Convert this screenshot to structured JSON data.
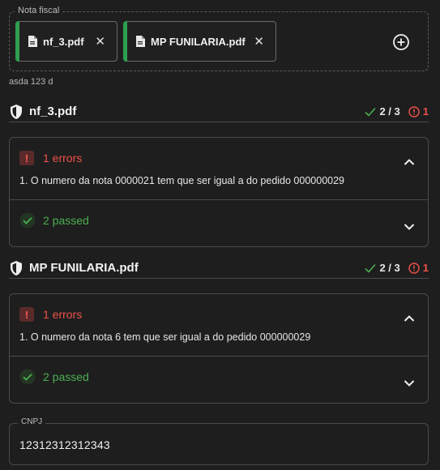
{
  "nota_fiscal": {
    "legend": "Nota fiscal",
    "files": [
      {
        "name": "nf_3.pdf",
        "close": "✕"
      },
      {
        "name": "MP FUNILARIA.pdf",
        "close": "✕"
      }
    ],
    "add_icon": "plus-circle-icon"
  },
  "helper_text": "asda 123 d",
  "sections": [
    {
      "file_name": "nf_3.pdf",
      "passed_ratio": "2 / 3",
      "error_count": "1",
      "errors_label": "1 errors",
      "errors_icon": "!",
      "error_messages": [
        "1. O numero da nota 0000021 tem que ser igual a do pedido 000000029"
      ],
      "passed_label": "2 passed"
    },
    {
      "file_name": "MP FUNILARIA.pdf",
      "passed_ratio": "2 / 3",
      "error_count": "1",
      "errors_label": "1 errors",
      "errors_icon": "!",
      "error_messages": [
        "1. O numero da nota 6 tem que ser igual a do pedido 000000029"
      ],
      "passed_label": "2 passed"
    }
  ],
  "cnpj": {
    "label": "CNPJ",
    "value": "12312312312343"
  },
  "colors": {
    "background": "#1e1e1e",
    "success": "#4caf50",
    "error": "#f0524b",
    "chip_accent": "#2e9e4f"
  }
}
